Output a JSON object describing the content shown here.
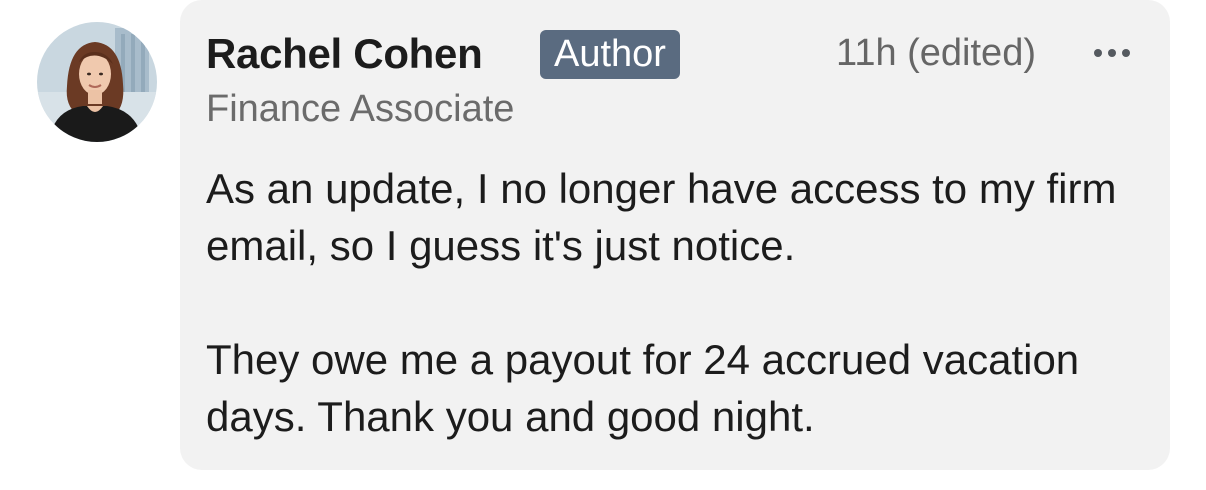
{
  "comment": {
    "author_name": "Rachel Cohen",
    "author_badge": "Author",
    "author_title": "Finance Associate",
    "timestamp": "11h (edited)",
    "more_icon": "ellipsis-icon",
    "avatar_icon": "profile-photo",
    "paragraphs": [
      "As an update, I no longer have access to my firm email, so I guess it's just notice.",
      "They owe me a payout for 24 accrued vacation days. Thank you and good night."
    ]
  },
  "colors": {
    "bubble_background": "#f2f2f2",
    "badge_background": "#5a6b80",
    "primary_text": "#1c1c1c",
    "secondary_text": "#666666"
  }
}
